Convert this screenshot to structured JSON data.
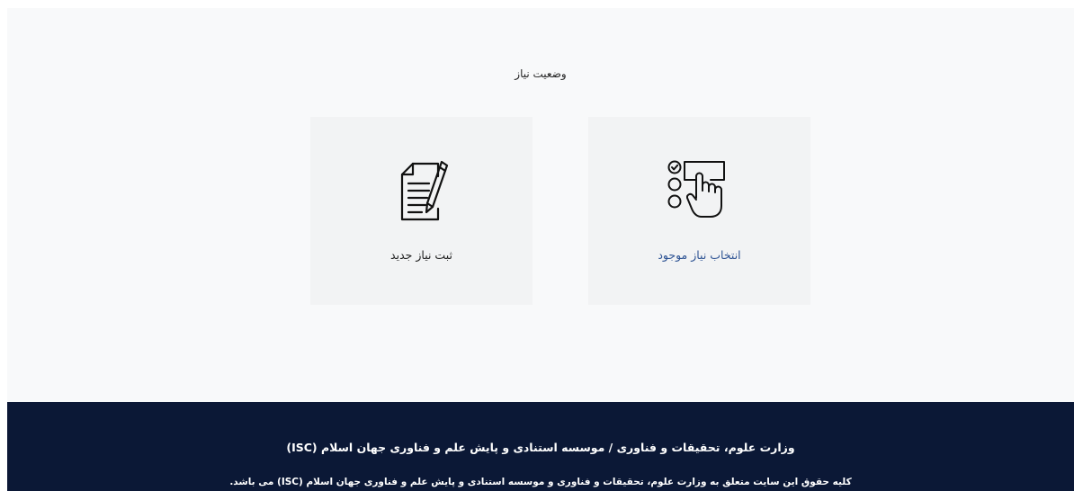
{
  "page": {
    "title": "وضعیت نیاز"
  },
  "cards": {
    "select_existing": {
      "label": "انتخاب نیاز موجود",
      "icon": "checklist-hand-pointer-icon",
      "label_color": "#2f5494"
    },
    "register_new": {
      "label": "ثبت نیاز جدید",
      "icon": "document-pen-icon",
      "label_color": "#222222"
    }
  },
  "footer": {
    "line1": "وزارت علوم، تحقیقات و فناوری / موسسه استنادی و پایش علم و فناوری جهان اسلام (ISC)",
    "line2": "کلیه حقوق این سایت متعلق به وزارت علوم، تحقیقات و فناوری و موسسه استنادی و پایش علم و فناوری جهان اسلام (ISC) می باشد.",
    "background": "#0b1836"
  }
}
